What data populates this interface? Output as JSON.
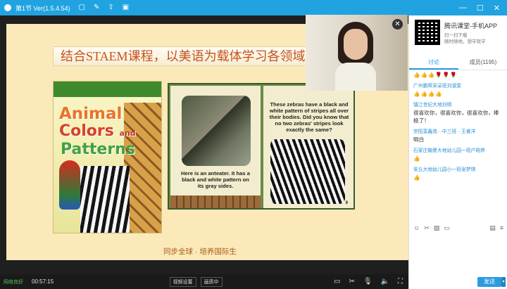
{
  "titlebar": {
    "title": "第1节 Ver(1.5.4.54)",
    "window_controls": [
      "minimize-icon",
      "maximize-icon",
      "close-icon"
    ],
    "accent_color": "#20a3e0"
  },
  "slide": {
    "banner": "结合STAEM课程，以美语为载体学习各领域",
    "cover": {
      "line1": "Animal",
      "line2": "Colors",
      "and": "and",
      "line3": "Patterns"
    },
    "page_left_text": "Here is an anteater. It has a black and white pattern on its gray sides.",
    "page_right_text": "These zebras have a black and white pattern of stripes all over their bodies. Did you know that no two zebras' stripes look exactly the same?",
    "page_number": "9",
    "caption": "同步全球 · 培养国际生"
  },
  "bottombar": {
    "network": "网络良好",
    "time": "00:57:15",
    "video_settings": "视频设置",
    "smooth": "画质中",
    "icons": [
      "screen-icon",
      "scissors-icon",
      "mic-icon",
      "speaker-icon",
      "fullscreen-icon"
    ]
  },
  "sidebar": {
    "app_title": "腾讯课堂-手机APP",
    "app_sub1": "扫一扫下载",
    "app_sub2": "随时随地，想学就学",
    "tabs": [
      "讨论",
      "成员(1195)"
    ],
    "messages": [
      {
        "name": "",
        "text": "👍👍👍🌹🌹🌹"
      },
      {
        "name": "广州鹏晖采朵班刘淑雯",
        "text": "👍👍👍👍"
      },
      {
        "name": "镇江世纪大地刘明",
        "text": "很喜欢你，很喜欢你，很喜欢你，棒极了！"
      },
      {
        "name": "宗阳富鑫苑···中三班···王睿洋",
        "text": "明白"
      },
      {
        "name": "石家庄翰景大地幼儿园一班户晗婷",
        "text": "👍"
      },
      {
        "name": "安丘大地幼儿园小一班张梦琪",
        "text": "👍"
      }
    ],
    "send": "发送"
  }
}
